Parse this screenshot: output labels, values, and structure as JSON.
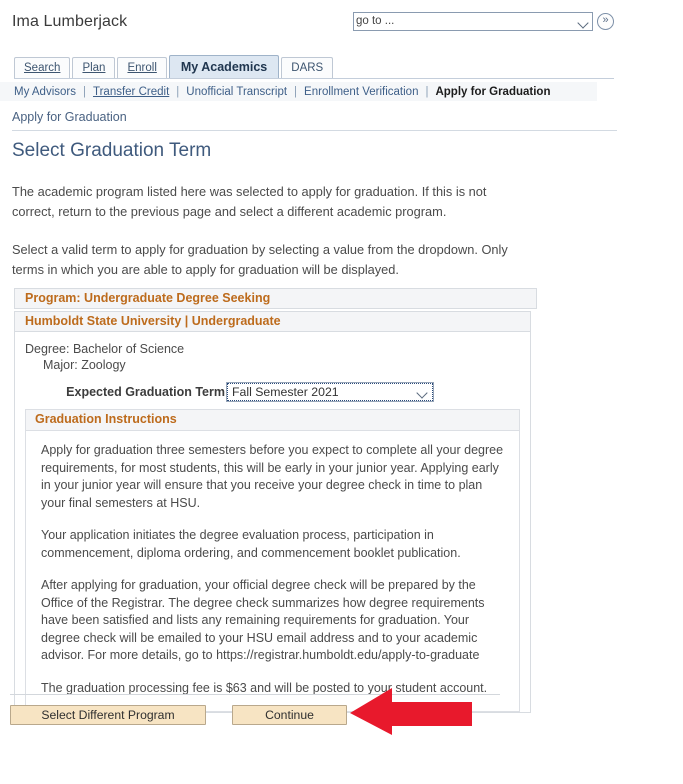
{
  "header": {
    "user_name": "Ima Lumberjack",
    "goto": {
      "value": "go to ...",
      "caret_icon": "chevron-down-icon",
      "go_button_icon": "double-chevron-right-icon",
      "go_button_label": "»"
    }
  },
  "tabs": [
    {
      "label": "Search",
      "active": false
    },
    {
      "label": "Plan",
      "active": false
    },
    {
      "label": "Enroll",
      "active": false
    },
    {
      "label": "My Academics",
      "active": true
    },
    {
      "label": "DARS",
      "active": false
    }
  ],
  "subnav": {
    "items": [
      {
        "label": "My Advisors",
        "current": false
      },
      {
        "label": "Transfer Credit",
        "current": false
      },
      {
        "label": "Unofficial Transcript",
        "current": false
      },
      {
        "label": "Enrollment Verification",
        "current": false
      },
      {
        "label": "Apply for Graduation",
        "current": true
      }
    ],
    "separator": "|"
  },
  "breadcrumb": "Apply for Graduation",
  "page_title": "Select Graduation Term",
  "intro": {
    "paragraph1": "The academic program listed here was selected to apply for graduation. If this is not correct, return to the previous page and select a different academic program.",
    "paragraph2": "Select a valid term to apply for graduation by selecting a value from the dropdown. Only terms in which you are able to apply for graduation will be displayed."
  },
  "program": {
    "program_band": "Program: Undergraduate Degree Seeking",
    "institution_band": "Humboldt State University | Undergraduate",
    "degree_line": "Degree: Bachelor of Science",
    "major_line": "Major: Zoology",
    "term_label": "Expected Graduation Term",
    "term_value": "Fall Semester 2021",
    "term_caret_icon": "chevron-down-icon"
  },
  "instructions": {
    "heading": "Graduation Instructions",
    "paragraphs": [
      "Apply for graduation three semesters before you expect to complete all your degree requirements, for most students, this will be early in your junior year. Applying early in your junior year will ensure that you receive your degree check in time to plan your final semesters at HSU.",
      "Your application initiates the degree evaluation process, participation in commencement, diploma ordering, and commencement booklet publication.",
      "After applying for graduation, your official degree check will be prepared by the Office of the Registrar. The degree check summarizes how degree requirements have been satisfied and lists any remaining requirements for graduation. Your degree check will be emailed to your HSU email address and to your academic advisor. For more details, go to https://registrar.humboldt.edu/apply-to-graduate",
      "The graduation processing fee is $63 and will be posted to your student account."
    ]
  },
  "footer": {
    "select_different_program_label": "Select Different Program",
    "continue_label": "Continue"
  },
  "annotation": {
    "arrow_icon": "left-arrow-annotation",
    "arrow_color": "#E8192C"
  },
  "colors": {
    "band_text": "#bd6b1c",
    "title_text": "#3f5a7d",
    "button_fill": "#f7e4c3",
    "active_tab": "#dde7f2"
  }
}
